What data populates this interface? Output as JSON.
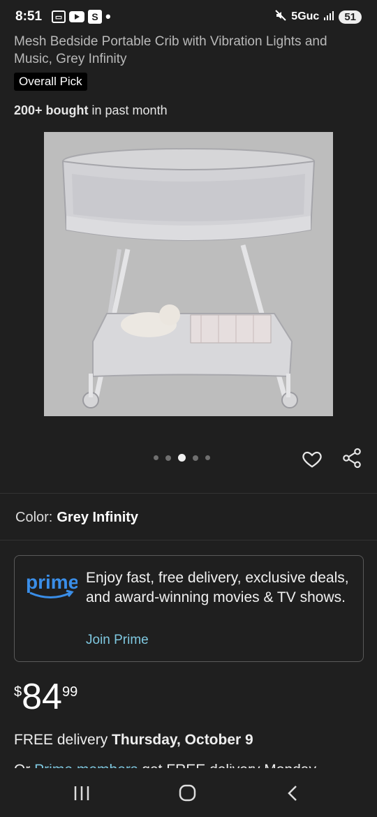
{
  "status_bar": {
    "time": "8:51",
    "network": "5Guc",
    "battery": "51",
    "icons": [
      "screenshot-icon",
      "youtube-icon",
      "s-app-icon",
      "notification-dot-icon",
      "mute-icon",
      "signal-icon"
    ]
  },
  "product": {
    "title": "Mesh Bedside Portable Crib with Vibration Lights and Music, Grey Infinity",
    "badge": "Overall Pick",
    "bought_bold": "200+ bought",
    "bought_rest": " in past month"
  },
  "gallery": {
    "image_count": 5,
    "active_index": 2
  },
  "color": {
    "label": "Color:",
    "value": "Grey Infinity"
  },
  "prime": {
    "logo": "prime",
    "message": "Enjoy fast, free delivery, exclusive deals, and award-winning movies & TV shows.",
    "join_label": "Join Prime",
    "accent": "#7fc8e0"
  },
  "price": {
    "symbol": "$",
    "whole": "84",
    "fraction": "99"
  },
  "delivery": {
    "prefix": "FREE delivery ",
    "date": "Thursday, October 9",
    "alt_prefix": "Or ",
    "alt_link": "Prime members",
    "alt_rest": " get FREE delivery Monday"
  },
  "colors": {
    "background": "#1f1f1f",
    "image_bg": "#bcbcbc",
    "link": "#7fc8e0",
    "prime_blue": "#3a8ee8"
  }
}
